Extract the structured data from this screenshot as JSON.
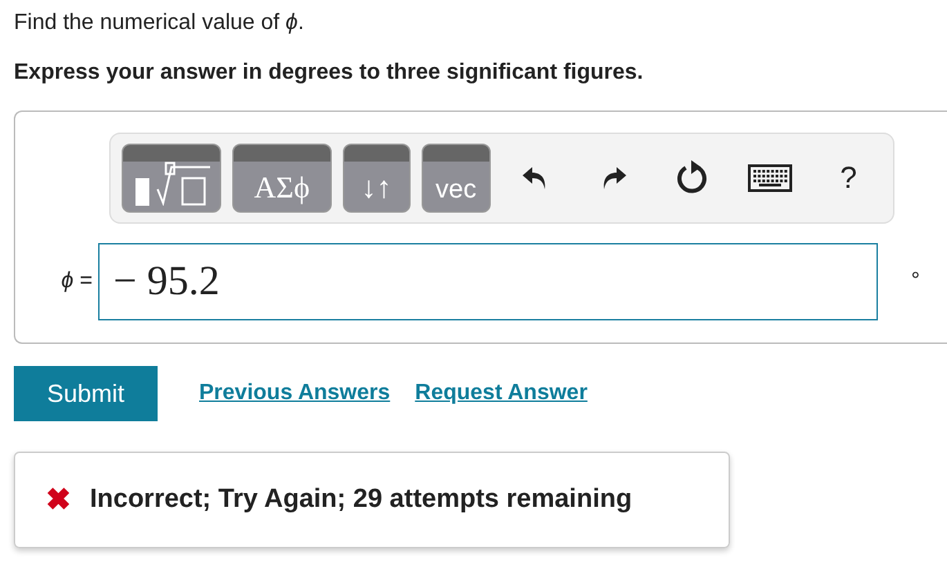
{
  "question": "Find the numerical value of *ϕ*.",
  "instruction": "Express your answer in degrees to three significant figures.",
  "toolbar": [
    {
      "kind": "template"
    },
    {
      "kind": "text",
      "label": "ΑΣϕ"
    },
    {
      "kind": "text",
      "label": "↓↑"
    },
    {
      "kind": "sans_text",
      "label": "vec"
    },
    {
      "kind": "undo"
    },
    {
      "kind": "redo"
    },
    {
      "kind": "reset"
    },
    {
      "kind": "keyboard"
    },
    {
      "kind": "help",
      "label": "?"
    }
  ],
  "answer": {
    "variable": "ϕ",
    "equals": "=",
    "value": "− 95.2",
    "unit": "°"
  },
  "submit": "Submit",
  "links": [
    "Previous Answers",
    "Request Answer"
  ],
  "feedback": {
    "mark": "✖",
    "text": "Incorrect; Try Again; 29 attempts remaining"
  }
}
